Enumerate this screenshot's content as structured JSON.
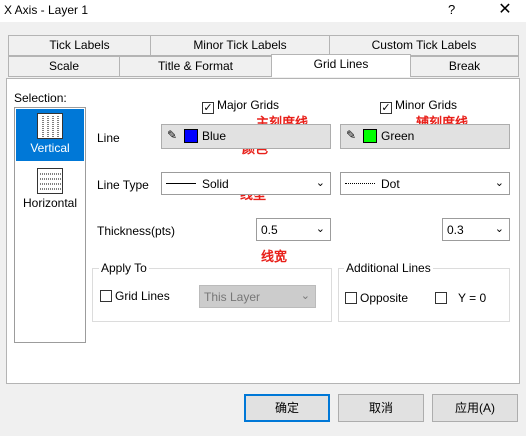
{
  "window": {
    "title": "X Axis - Layer 1",
    "help": "?",
    "close": "✕"
  },
  "tabs_row1": [
    "Tick Labels",
    "Minor Tick Labels",
    "Custom Tick Labels"
  ],
  "tabs_row2": [
    "Scale",
    "Title & Format",
    "Grid Lines",
    "Break"
  ],
  "active_tab": "Grid Lines",
  "selection": {
    "label": "Selection:",
    "items": [
      "Vertical",
      "Horizontal"
    ],
    "selected": "Vertical"
  },
  "major": {
    "checkbox_label": "Major Grids",
    "checked": true,
    "color_label": "Blue",
    "color": "#0000ff",
    "line_type": "Solid",
    "thickness": "0.5"
  },
  "minor": {
    "checkbox_label": "Minor Grids",
    "checked": true,
    "color_label": "Green",
    "color": "#00ff00",
    "line_type": "Dot",
    "thickness": "0.3"
  },
  "row_labels": {
    "line": "Line",
    "line_type": "Line Type",
    "thickness": "Thickness(pts)"
  },
  "apply_to": {
    "title": "Apply To",
    "checkbox_label": "Grid Lines",
    "checked": false,
    "combo_value": "This Layer"
  },
  "additional": {
    "title": "Additional Lines",
    "opposite_label": "Opposite",
    "opposite_checked": false,
    "y0_label": "Y = 0",
    "y0_checked": false
  },
  "annotations": {
    "major": "主刻度线",
    "minor": "辅刻度线",
    "color": "颜色",
    "line_type": "线型",
    "width": "线宽"
  },
  "buttons": {
    "ok": "确定",
    "cancel": "取消",
    "apply": "应用(A)"
  }
}
